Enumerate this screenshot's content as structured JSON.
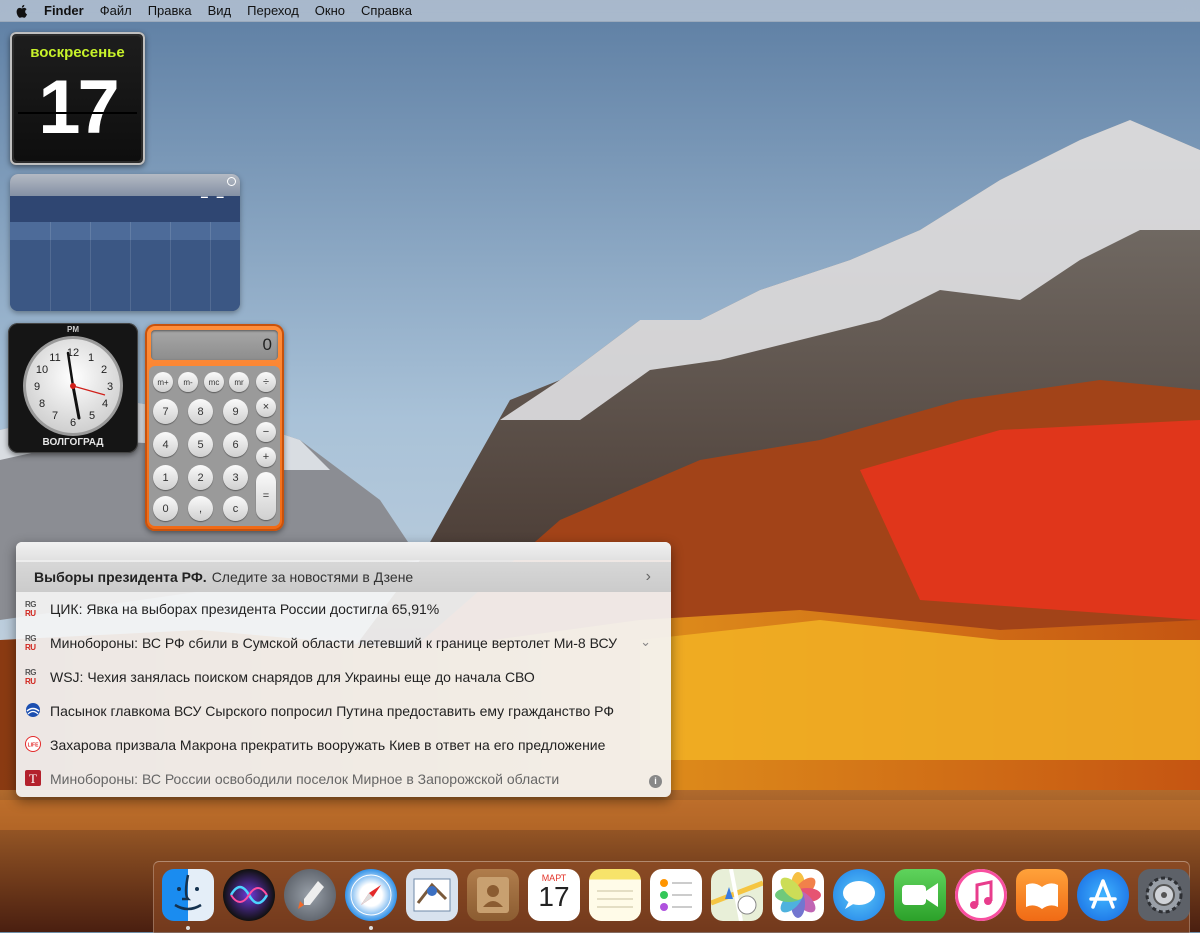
{
  "menubar": {
    "app_name": "Finder",
    "items": [
      "Файл",
      "Правка",
      "Вид",
      "Переход",
      "Окно",
      "Справка"
    ]
  },
  "calendar_widget": {
    "day_of_week": "воскресенье",
    "day": "17"
  },
  "weather_widget": {
    "temperature": "– –"
  },
  "clock_widget": {
    "period": "PM",
    "city": "ВОЛГОГРАД",
    "numerals": [
      "12",
      "1",
      "2",
      "3",
      "4",
      "5",
      "6",
      "7",
      "8",
      "9",
      "10",
      "11"
    ]
  },
  "calculator_widget": {
    "display": "0",
    "memory_keys": [
      "m+",
      "m-",
      "mc",
      "mr",
      "÷"
    ],
    "rows": [
      [
        "7",
        "8",
        "9",
        "×"
      ],
      [
        "4",
        "5",
        "6",
        "−"
      ],
      [
        "1",
        "2",
        "3",
        "+"
      ]
    ],
    "bottom": [
      "0",
      ",",
      "c",
      "="
    ]
  },
  "news": {
    "header_bold": "Выборы президента РФ.",
    "header_text": "Следите за новостями в Дзене",
    "items": [
      {
        "text": "ЦИК: Явка на выборах президента России достигла 65,91%",
        "source": "rg-icon"
      },
      {
        "text": "Минобороны: ВС РФ сбили в Сумской области летевший к границе вертолет Ми-8 ВСУ",
        "source": "rg-icon"
      },
      {
        "text": "WSJ: Чехия занялась поиском снарядов для Украины еще до начала СВО",
        "source": "rg-icon"
      },
      {
        "text": "Пасынок главкома ВСУ Сырского попросил Путина предоставить ему гражданство РФ",
        "source": "globe-icon"
      },
      {
        "text": "Захарова призвала Макрона прекратить вооружать Киев в ответ на его предложение",
        "source": "life-icon"
      },
      {
        "text": "Минобороны: ВС России освободили поселок Мирное в Запорожской области",
        "source": "t-icon"
      }
    ],
    "rg_top": "RG",
    "rg_bottom": "RU",
    "life_label": "LIFE",
    "t_label": "T",
    "info_label": "i"
  },
  "dock": {
    "calendar_month": "МАРТ",
    "calendar_day": "17",
    "apps": [
      "Finder",
      "Siri",
      "Launchpad",
      "Safari",
      "Mail",
      "Contacts",
      "Calendar",
      "Notes",
      "Reminders",
      "Maps",
      "Photos",
      "Messages",
      "FaceTime",
      "iTunes",
      "iBooks",
      "App Store",
      "System Preferences"
    ]
  }
}
